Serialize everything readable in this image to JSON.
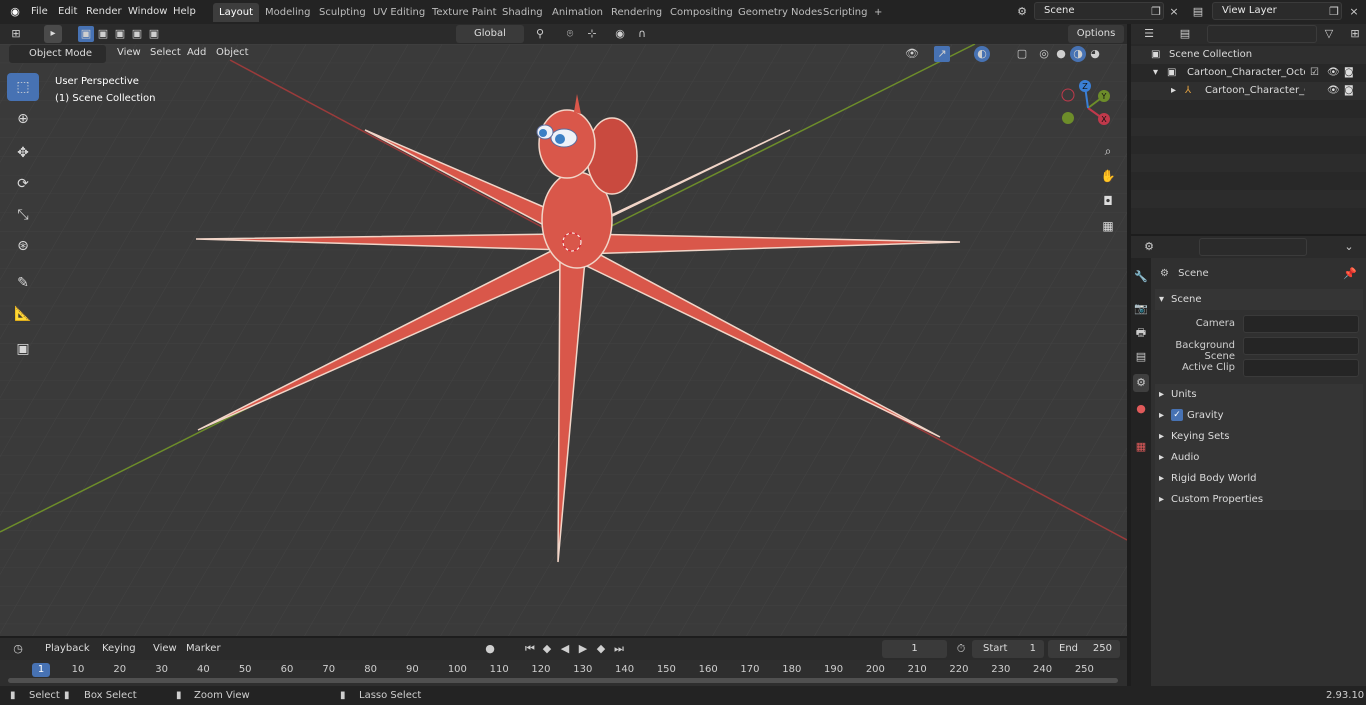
{
  "top_menu": {
    "items": [
      "File",
      "Edit",
      "Render",
      "Window",
      "Help"
    ]
  },
  "workspaces": {
    "active": "Layout",
    "tabs": [
      "Layout",
      "Modeling",
      "Sculpting",
      "UV Editing",
      "Texture Paint",
      "Shading",
      "Animation",
      "Rendering",
      "Compositing",
      "Geometry Nodes",
      "Scripting"
    ],
    "add": "+"
  },
  "scene_selector": {
    "value": "Scene"
  },
  "view_layer": {
    "value": "View Layer"
  },
  "viewport_header": {
    "mode": "Object Mode",
    "menus": [
      "View",
      "Select",
      "Add",
      "Object"
    ],
    "orientation": "Global",
    "options": "Options"
  },
  "viewport": {
    "perspective": "User Perspective",
    "collection": "(1) Scene Collection",
    "axes": {
      "x": "X",
      "y": "Y",
      "z": "Z"
    }
  },
  "outliner": {
    "search_placeholder": "",
    "root": "Scene Collection",
    "child": "Cartoon_Character_Octopus_",
    "grandchild": "Cartoon_Character_Octo"
  },
  "properties": {
    "breadcrumb": "Scene",
    "section": "Scene",
    "camera_label": "Camera",
    "bg_scene_label": "Background Scene",
    "active_clip_label": "Active Clip",
    "panels": [
      "Units",
      "Gravity",
      "Keying Sets",
      "Audio",
      "Rigid Body World",
      "Custom Properties"
    ],
    "gravity_checked": true
  },
  "timeline": {
    "menus": [
      "Playback",
      "Keying",
      "View",
      "Marker"
    ],
    "current_frame": "1",
    "start_label": "Start",
    "start": "1",
    "end_label": "End",
    "end": "250",
    "frames": [
      "1",
      "10",
      "20",
      "30",
      "40",
      "50",
      "60",
      "70",
      "80",
      "90",
      "100",
      "110",
      "120",
      "130",
      "140",
      "150",
      "160",
      "170",
      "180",
      "190",
      "200",
      "210",
      "220",
      "230",
      "240",
      "250"
    ]
  },
  "statusbar": {
    "select": "Select",
    "box_select": "Box Select",
    "zoom_view": "Zoom View",
    "lasso_select": "Lasso Select",
    "version": "2.93.10"
  },
  "colors": {
    "accent": "#4772b3",
    "octopus": "#d9574a",
    "x_axis": "#9a3b3b",
    "y_axis": "#6d8d2a"
  }
}
